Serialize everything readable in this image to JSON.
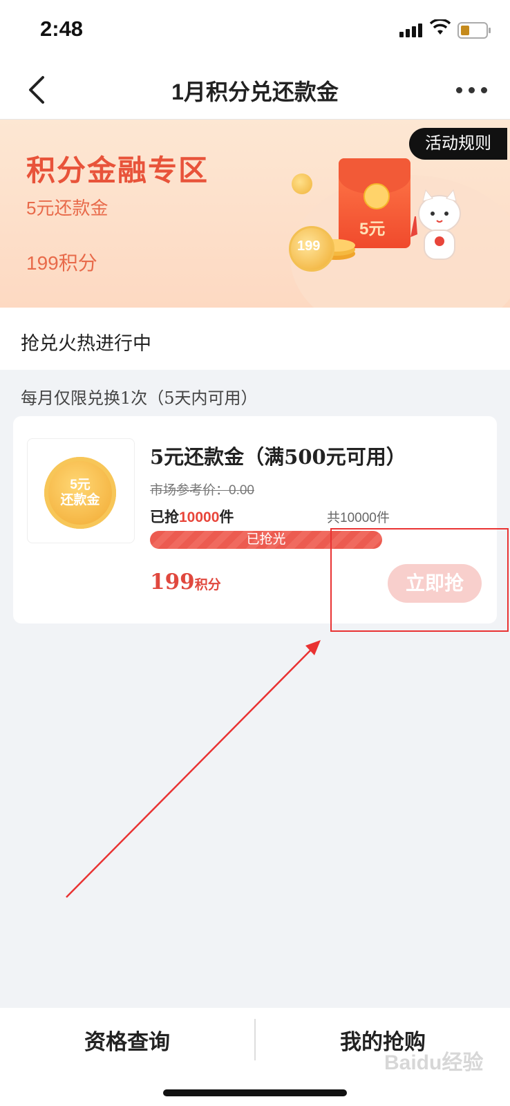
{
  "status_bar": {
    "time": "2:48"
  },
  "nav": {
    "title": "1月积分兑还款金"
  },
  "banner": {
    "title": "积分金融专区",
    "subtitle": "5元还款金",
    "points": "199积分",
    "rules_label": "活动规则",
    "envelope_label": "5元",
    "coin_label": "199"
  },
  "hot": {
    "text": "抢兑火热进行中"
  },
  "limit": {
    "text": "每月仅限兑换1次（5天内可用）"
  },
  "product": {
    "thumb_text": "5元\n还款金",
    "title": "5元还款金（满500元可用）",
    "market_price": "市场参考价：0.00",
    "sold_prefix": "已抢",
    "sold_count": "10000",
    "sold_suffix": "件",
    "total": "共10000件",
    "progress_label": "已抢光",
    "progress": 1.0,
    "price": "199",
    "price_unit": "积分",
    "grab_label": "立即抢"
  },
  "bottom": {
    "qualification": "资格查询",
    "my_purchases": "我的抢购"
  },
  "watermark": "Baidu经验",
  "colors": {
    "accent": "#e8453a",
    "banner_bg": "#fde7d3",
    "button_disabled": "#f8cfcc",
    "annotation": "#e93232"
  }
}
